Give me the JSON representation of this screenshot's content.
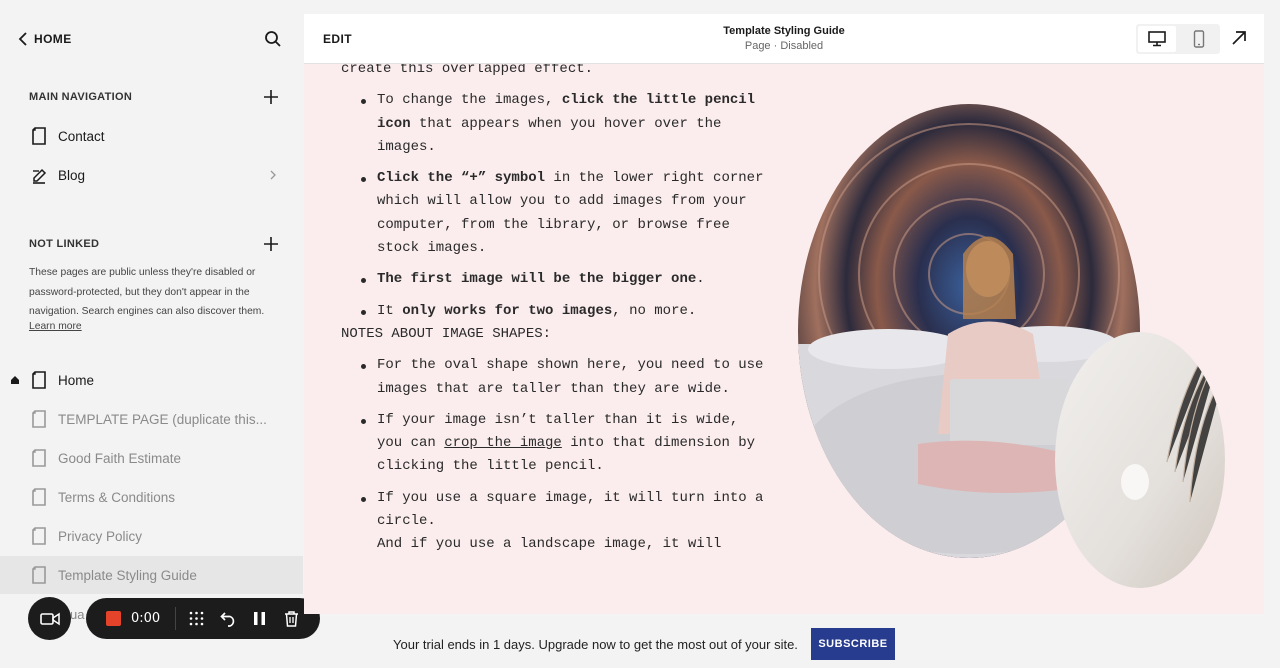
{
  "sidebar": {
    "back_label": "HOME",
    "main_nav": {
      "heading": "MAIN NAVIGATION",
      "items": [
        {
          "label": "Contact"
        },
        {
          "label": "Blog"
        }
      ]
    },
    "not_linked": {
      "heading": "NOT LINKED",
      "note": "These pages are public unless they're disabled or password-protected, but they don't appear in the navigation. Search engines can also discover them.",
      "learn_more": "Learn more",
      "items": [
        {
          "label": "Home"
        },
        {
          "label": "TEMPLATE PAGE (duplicate this..."
        },
        {
          "label": "Good Faith Estimate"
        },
        {
          "label": "Terms & Conditions"
        },
        {
          "label": "Privacy Policy"
        },
        {
          "label": "Template Styling Guide"
        }
      ],
      "peek": "ua"
    }
  },
  "recorder": {
    "time": "0:00",
    "stop_color": "#e5432a"
  },
  "preview": {
    "edit_label": "EDIT",
    "title": "Template Styling Guide",
    "subtitle": "Page · Disabled",
    "background": "#fbeded",
    "text": {
      "intro": "create this overlapped effect.",
      "b1_pre": "To change the images, ",
      "b1_bold": "click the little pencil icon",
      "b1_post": " that appears when you hover over the images.",
      "b2_bold": "Click the “+” symbol",
      "b2_post": " in the lower right corner which will allow you to add images from your computer, from the library, or browse free stock images.",
      "b3_bold": "The first image will be the bigger one",
      "b3_post": ".",
      "b4_pre": "It ",
      "b4_bold": "only works for two images",
      "b4_post": ", no more.",
      "heading": "NOTES ABOUT IMAGE SHAPES:",
      "n1": "For the oval shape shown here, you need to use images that are taller than they are wide.",
      "n2_pre": "If your image isn’t taller than it is wide, you can ",
      "n2_link": "crop the image",
      "n2_post": " into that dimension by clicking the little pencil.",
      "n3": "If you use a square image, it will turn into a circle.",
      "n4": "And if you use a landscape image, it will"
    }
  },
  "trial": {
    "message": "Your trial ends in 1 days. Upgrade now to get the most out of your site.",
    "subscribe_label": "SUBSCRIBE",
    "accent": "#273b8f"
  }
}
